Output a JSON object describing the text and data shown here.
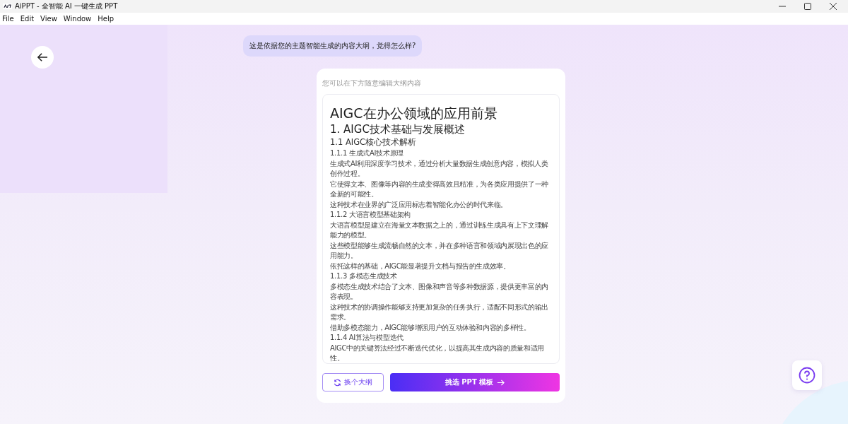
{
  "window": {
    "title": "AiPPT - 全智能 AI 一键生成 PPT"
  },
  "menu": [
    "File",
    "Edit",
    "View",
    "Window",
    "Help"
  ],
  "chat_bubble": "这是依据您的主题智能生成的内容大纲，觉得怎么样?",
  "outline_card": {
    "hint": "您可以在下方随意编辑大纲内容",
    "lines": [
      {
        "kind": "h1",
        "text": "AIGC在办公领域的应用前景"
      },
      {
        "kind": "h2",
        "text": "1. AIGC技术基础与发展概述"
      },
      {
        "kind": "h3",
        "text": "1.1 AIGC核心技术解析"
      },
      {
        "kind": "h4",
        "text": "1.1.1 生成式AI技术原理"
      },
      {
        "kind": "p",
        "text": "生成式AI利用深度学习技术，通过分析大量数据生成创意内容，模拟人类创作过程。"
      },
      {
        "kind": "p",
        "text": "它使得文本、图像等内容的生成变得高效且精准，为各类应用提供了一种全新的可能性。"
      },
      {
        "kind": "p",
        "text": "这种技术在业界的广泛应用标志着智能化办公的时代来临。"
      },
      {
        "kind": "h4",
        "text": "1.1.2 大语言模型基础架构"
      },
      {
        "kind": "p",
        "text": "大语言模型是建立在海量文本数据之上的，通过训练生成具有上下文理解能力的模型。"
      },
      {
        "kind": "p",
        "text": "这些模型能够生成流畅自然的文本，并在多种语言和领域内展现出色的应用能力。"
      },
      {
        "kind": "p",
        "text": "依托这样的基础，AIGC能显著提升文档与报告的生成效率。"
      },
      {
        "kind": "h4",
        "text": "1.1.3 多模态生成技术"
      },
      {
        "kind": "p",
        "text": "多模态生成技术结合了文本、图像和声音等多种数据源，提供更丰富的内容表现。"
      },
      {
        "kind": "p",
        "text": "这种技术的协调操作能够支持更加复杂的任务执行，适配不同形式的输出需求。"
      },
      {
        "kind": "p",
        "text": "借助多模态能力，AIGC能够增强用户的互动体验和内容的多样性。"
      },
      {
        "kind": "h4",
        "text": "1.1.4 AI算法与模型迭代"
      },
      {
        "kind": "p",
        "text": "AIGC中的关键算法经过不断迭代优化，以提高其生成内容的质量和适用性。"
      }
    ],
    "buttons": [
      {
        "kind": "secondary",
        "label": "换个大纲"
      },
      {
        "kind": "primary",
        "label": "挑选 PPT 模板"
      }
    ]
  }
}
